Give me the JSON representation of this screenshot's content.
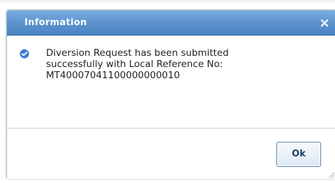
{
  "dialog": {
    "title": "Information",
    "close_icon": "close-icon",
    "status_icon": "check-circle-icon",
    "message_lines": [
      "Diversion Request has been submitted",
      "successfully with Local Reference No:",
      "MT40007041100000000010"
    ],
    "ok_label": "Ok"
  },
  "colors": {
    "titlebar": "#5f95cf",
    "title_text": "#ffffff",
    "check_icon": "#3a7fcf",
    "button_border": "#5a7fa6"
  }
}
